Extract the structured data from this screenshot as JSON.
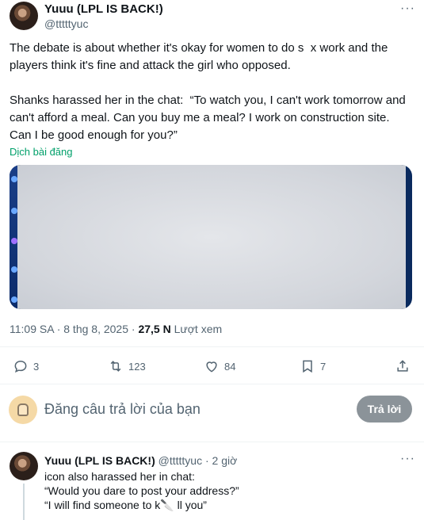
{
  "tweet": {
    "author_name": "Yuuu (LPL IS BACK!)",
    "author_handle": "@tttttyuc",
    "text": "The debate is about whether it's okay for women to do s  x work and the players think it's fine and attack the girl who opposed.\n\nShanks harassed her in the chat:  “To watch you, I can't work tomorrow and can't afford a meal. Can you buy me a meal? I work on construction site. Can I be good enough for you?”",
    "translate_label": "Dịch bài đăng",
    "time": "11:09 SA",
    "date": "8 thg 8, 2025",
    "views_count": "27,5 N",
    "views_label": "Lượt xem",
    "replies_count": "3",
    "reposts_count": "123",
    "likes_count": "84",
    "bookmarks_count": "7"
  },
  "composer": {
    "placeholder": "Đăng câu trả lời của bạn",
    "reply_button_label": "Trả lời"
  },
  "reply": {
    "author_name": "Yuuu (LPL IS BACK!)",
    "author_handle": "@tttttyuc",
    "separator": "·",
    "time_ago": "2 giờ",
    "lines": [
      "icon also harassed her in chat:",
      "“Would you dare to post your address?”",
      "“I will find someone to k🔪 ll you”"
    ]
  },
  "colors": {
    "accent": "#1d9bf0",
    "translate_link": "#00a06a",
    "secondary_text": "#536471",
    "reply_button": "#8b9399"
  }
}
